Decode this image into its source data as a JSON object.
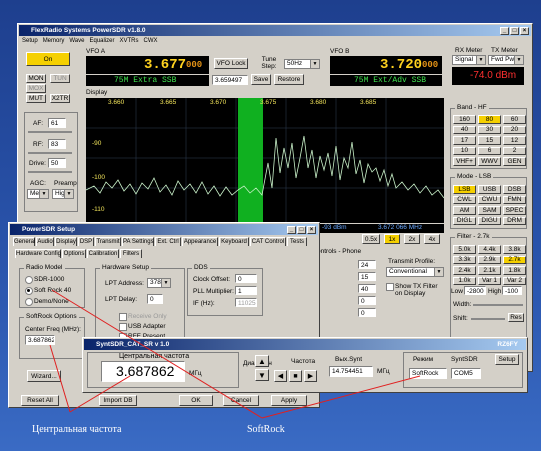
{
  "main": {
    "title": "FlexRadio Systems PowerSDR v1.8.0",
    "menu": [
      "Setup",
      "Memory",
      "Wave",
      "Equalizer",
      "XVTRs",
      "CWX"
    ],
    "on_label": "On",
    "mon_label": "MON",
    "tun_label": "TUN",
    "mox_label": "MOX",
    "mut_label": "MUT",
    "xtr_label": "X2TR",
    "vfoa": {
      "label": "VFO A",
      "freq_main": "3.677",
      "freq_sub": "000",
      "band": "75M Extra SSB"
    },
    "vfob": {
      "label": "VFO B",
      "freq_main": "3.720",
      "freq_sub": "000",
      "band": "75M Ext/Adv SSB"
    },
    "vfo_lock": "VFO Lock",
    "tune_step_label": "Tune Step:",
    "tune_step_value": "50Hz",
    "entry_value": "3.659497",
    "save": "Save",
    "restore": "Restore",
    "rx_meter": "RX Meter",
    "tx_meter": "TX Meter",
    "rx_meter_sel": "Signal",
    "tx_meter_sel": "Fwd Pwr",
    "dbm": "-74.0 dBm",
    "display_label": "Display",
    "display_freqs": [
      "3.660",
      "3.665",
      "3.670",
      "3.675",
      "3.680",
      "3.685"
    ],
    "display_db": [
      "-90",
      "-100",
      "-110"
    ],
    "display_status": [
      "-93 dBm",
      "3.672 066 MHz"
    ],
    "zoom": [
      "0.5x",
      "1x",
      "2x",
      "4x"
    ],
    "af_label": "AF:",
    "af_value": "61",
    "rf_label": "RF:",
    "rf_value": "83",
    "drive_label": "Drive:",
    "drive_value": "50",
    "agc_label": "AGC:",
    "agc_value": "Med",
    "preamp_label": "Preamp",
    "preamp_value": "High",
    "controls_phone": "ontrols - Phone",
    "transmit_profile": "Transmit Profile:",
    "transmit_profile_value": "Conventional",
    "show_tx_filter": "Show TX Filter on Display",
    "phone_values": [
      "24",
      "15",
      "40",
      "0",
      "0"
    ],
    "band_label": "Band - HF",
    "bands": [
      "160",
      "80",
      "60",
      "40",
      "30",
      "20",
      "17",
      "15",
      "12",
      "10",
      "6",
      "2",
      "VHF+",
      "WWV",
      "GEN"
    ],
    "mode_label": "Mode - LSB",
    "modes": [
      "LSB",
      "USB",
      "DSB",
      "CWL",
      "CWU",
      "FMN",
      "AM",
      "SAM",
      "SPEC",
      "DIGL",
      "DIGU",
      "DRM"
    ],
    "filter_label": "Filter - 2.7k",
    "filters": [
      "5.0k",
      "4.4k",
      "3.8k",
      "3.3k",
      "2.9k",
      "2.7k",
      "2.4k",
      "2.1k",
      "1.8k",
      "1.0k",
      "Var 1",
      "Var 2"
    ],
    "low_label": "Low",
    "low_value": "-2800",
    "high_label": "High",
    "high_value": "-100",
    "width_label": "Width:",
    "shift_label": "Shift:",
    "reset_label": "Res"
  },
  "setup": {
    "title": "PowerSDR Setup",
    "tabs": [
      "General",
      "Audio",
      "Display",
      "DSP",
      "Transmit",
      "PA Settings",
      "Ext. Ctrl",
      "Appearance",
      "Keyboard",
      "CAT Control",
      "Tests"
    ],
    "subtabs": [
      "Hardware Config",
      "Options",
      "Calibration",
      "Filters"
    ],
    "radio_model": "Radio Model",
    "models": [
      "SDR-1000",
      "Soft Rock 40",
      "Demo/None"
    ],
    "hardware_setup": "Hardware Setup",
    "lpt_address": "LPT Address:",
    "lpt_address_value": "378",
    "lpt_delay": "LPT Delay:",
    "lpt_delay_value": "0",
    "receive_only": "Receive Only",
    "usb_adapter": "USB Adapter",
    "rfe_present": "RFE Present",
    "dds": "DDS",
    "clock_offset": "Clock Offset:",
    "clock_offset_value": "0",
    "pll_multiplier": "PLL Multiplier:",
    "pll_multiplier_value": "1",
    "if_hz": "IF (Hz):",
    "if_value": "11025",
    "softrock_options": "SoftRock Options",
    "center_freq": "Center Freq (MHz):",
    "center_freq_value": "3.687862",
    "wizard": "Wizard...",
    "reset_all": "Reset All",
    "import_db": "Import DB",
    "ok": "OK",
    "cancel": "Cancel",
    "apply": "Apply"
  },
  "synt": {
    "title": "SyntSDR_CAT_SR v 1.0",
    "brand": "RZ6FY",
    "center_label": "Центральная частота",
    "center_value": "3.687862",
    "unit1": "МГц",
    "range_label": "Диапазон",
    "freq_label": "Частота",
    "out_label": "Вых.Synt",
    "out_value": "14.754451",
    "unit2": "МГц",
    "mode_label": "Режим",
    "syntsdr_label": "SyntSDR",
    "setup": "Setup",
    "mode_value": "SoftRock",
    "port_value": "COM5"
  },
  "annotations": {
    "center": "Центральная частота",
    "softrock": "SoftRock"
  }
}
